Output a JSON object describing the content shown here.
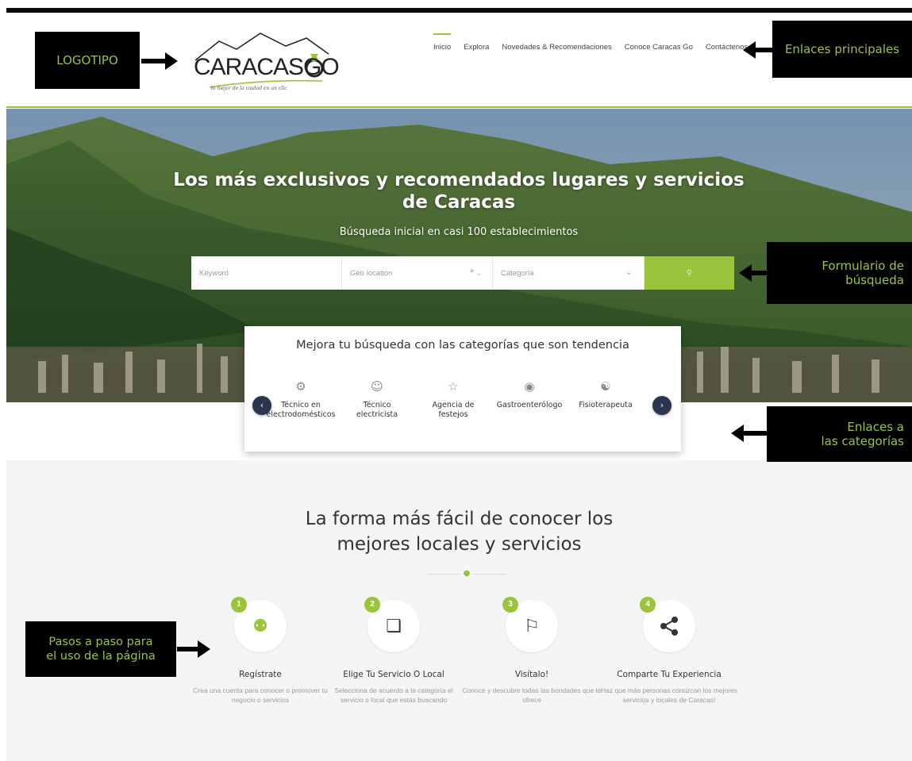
{
  "annotations": {
    "logo": "LOGOTIPO",
    "nav": "Enlaces principales",
    "search": "Formulario de\nbúsqueda",
    "categories": "Enlaces a\nlas categorías",
    "steps": "Pasos a paso para\nel uso de la página"
  },
  "header": {
    "logo_text": "CARACASGO",
    "logo_tagline": "lo mejor de la ciudad en un clic",
    "nav": [
      {
        "label": "Inicio",
        "active": true
      },
      {
        "label": "Explora"
      },
      {
        "label": "Novedades & Recomendaciones"
      },
      {
        "label": "Conoce Caracas Go"
      },
      {
        "label": "Contáctenos"
      }
    ]
  },
  "hero": {
    "title": "Los más exclusivos y recomendados lugares y servicios de Caracas",
    "subtitle": "Búsqueda inicial en casi 100 establecimientos",
    "search": {
      "keyword_placeholder": "Keyword",
      "geo_placeholder": "Geo location",
      "category_placeholder": "Categoría",
      "button_icon": "search-icon"
    }
  },
  "trending": {
    "title": "Mejora tu búsqueda con las categorías que son tendencia",
    "categories": [
      {
        "label": "Técnico en electrodomésticos",
        "icon": "technician-icon"
      },
      {
        "label": "Técnico electricista",
        "icon": "electrician-icon"
      },
      {
        "label": "Agencia de festejos",
        "icon": "party-icon"
      },
      {
        "label": "Gastroenterólogo",
        "icon": "doctor-icon"
      },
      {
        "label": "Fisioterapeuta",
        "icon": "physio-icon"
      }
    ]
  },
  "how": {
    "title_line1": "La forma más fácil de conocer los",
    "title_line2": "mejores locales y servicios",
    "steps": [
      {
        "num": "1",
        "title": "Regístrate",
        "desc": "Crea una cuenta para conocer o promover tu negocio o servicios",
        "icon": "users-icon"
      },
      {
        "num": "2",
        "title": "Elige Tu Servicio O Local",
        "desc": "Selecciona de acuerdo a la categoría el servicio o local que estás buscando",
        "icon": "cursor-icon"
      },
      {
        "num": "3",
        "title": "Visítalo!",
        "desc": "Conoce y descubre todas las bondades que te ofrece",
        "icon": "map-pin-icon"
      },
      {
        "num": "4",
        "title": "Comparte Tu Experiencia",
        "desc": "Haz que más personas conozcan los mejores servicios y locales de Caracas!",
        "icon": "share-icon"
      }
    ]
  },
  "colors": {
    "accent": "#9ac43c",
    "callout_bg": "#000000",
    "carousel_btn": "#2c3550"
  }
}
